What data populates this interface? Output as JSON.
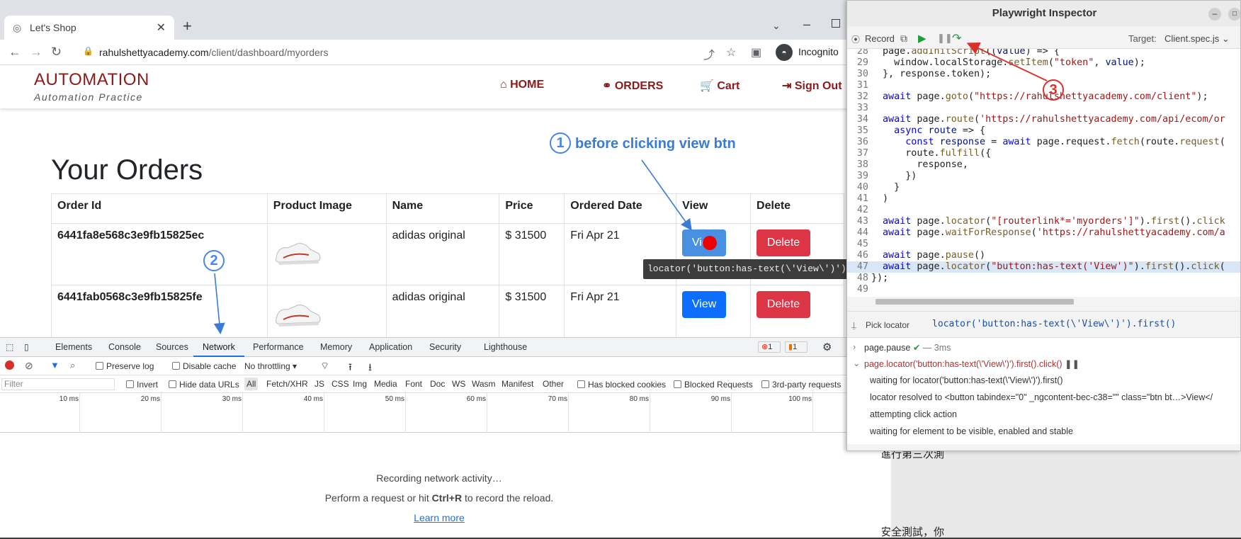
{
  "browser": {
    "tab_title": "Let's Shop",
    "url_host": "rahulshettyacademy.com",
    "url_path": "/client/dashboard/myorders",
    "incognito_label": "Incognito"
  },
  "site": {
    "logo_main": "AUTOMATION",
    "logo_sub": "Automation Practice",
    "nav": [
      "HOME",
      "ORDERS",
      "Cart",
      "Sign Out"
    ]
  },
  "orders": {
    "title": "Your Orders",
    "columns": [
      "Order Id",
      "Product Image",
      "Name",
      "Price",
      "Ordered Date",
      "View",
      "Delete"
    ],
    "rows": [
      {
        "id": "6441fa8e568c3e9fb15825ec",
        "name": "adidas original",
        "price": "$ 31500",
        "date": "Fri Apr 21",
        "view": "View",
        "delete": "Delete"
      },
      {
        "id": "6441fab0568c3e9fb15825fe",
        "name": "adidas original",
        "price": "$ 31500",
        "date": "Fri Apr 21",
        "view": "View",
        "delete": "Delete"
      }
    ],
    "tooltip": "locator('button:has-text(\\'View\\')').first()"
  },
  "annotations": {
    "a1_num": "1",
    "a1_text": "before clicking view btn",
    "a2_num": "2",
    "a3_num": "3"
  },
  "devtools": {
    "tabs": [
      "Elements",
      "Console",
      "Sources",
      "Network",
      "Performance",
      "Memory",
      "Application",
      "Security",
      "Lighthouse"
    ],
    "active_tab": "Network",
    "errors": "1",
    "warnings": "1",
    "preserve_log": "Preserve log",
    "disable_cache": "Disable cache",
    "throttling": "No throttling",
    "filter_placeholder": "Filter",
    "invert": "Invert",
    "hide_data_urls": "Hide data URLs",
    "types": [
      "All",
      "Fetch/XHR",
      "JS",
      "CSS",
      "Img",
      "Media",
      "Font",
      "Doc",
      "WS",
      "Wasm",
      "Manifest",
      "Other"
    ],
    "has_blocked_cookies": "Has blocked cookies",
    "blocked_requests": "Blocked Requests",
    "third_party": "3rd-party requests",
    "ticks": [
      "10 ms",
      "20 ms",
      "30 ms",
      "40 ms",
      "50 ms",
      "60 ms",
      "70 ms",
      "80 ms",
      "90 ms",
      "100 ms"
    ],
    "msg1": "Recording network activity…",
    "msg2_pre": "Perform a request or hit ",
    "msg2_key": "Ctrl+R",
    "msg2_post": " to record the reload.",
    "learn_more": "Learn more"
  },
  "inspector": {
    "title": "Playwright Inspector",
    "record": "Record",
    "target_label": "Target:",
    "target_value": "Client.spec.js",
    "pick_locator": "Pick locator",
    "locator_value": "locator('button:has-text(\\'View\\')').first()",
    "log": [
      {
        "text": "page.pause",
        "time": "— 3ms"
      },
      {
        "text": "page.locator('button:has-text(\\'View\\')').first().click()"
      },
      {
        "text": "waiting for locator('button:has-text(\\'View\\')').first()"
      },
      {
        "text": "locator resolved to <button tabindex=\"0\" _ngcontent-bec-c38=\"\" class=\"btn bt…>View</"
      },
      {
        "text": "attempting click action"
      },
      {
        "text": "waiting for element to be visible, enabled and stable"
      }
    ]
  },
  "bg_doc": [
    "進行第三次測",
    "安全測試，你"
  ]
}
